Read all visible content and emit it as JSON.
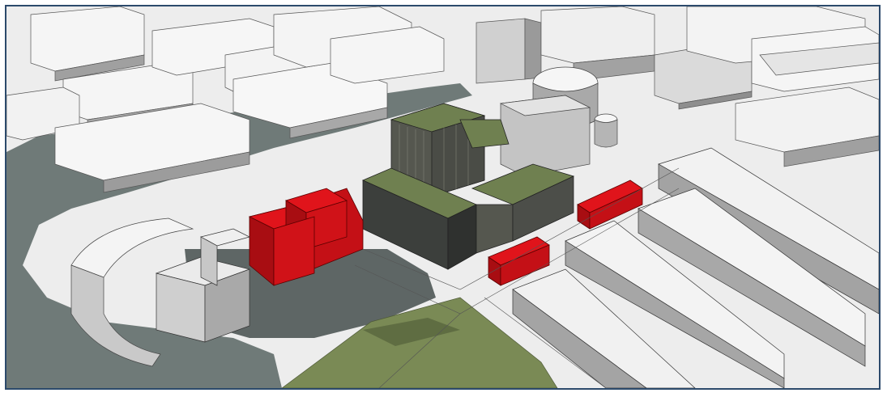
{
  "scene": {
    "kind": "3d-massing-render",
    "colors": {
      "frame": "#2c4a6b",
      "ground": "#ededed",
      "canal": "#6f7a78",
      "shadow": "#7d8483",
      "roof": "#f6f6f6",
      "wall_light": "#d8d8d8",
      "wall_dark": "#9a9a9a",
      "highlight_red": "#e0141b",
      "proposed_green": "#6f8050",
      "proposed_dark": "#3c3f3c",
      "lawn": "#7a8a55"
    },
    "highlighted_buildings": 3,
    "proposed_development": "tower-with-podium-blocks"
  }
}
